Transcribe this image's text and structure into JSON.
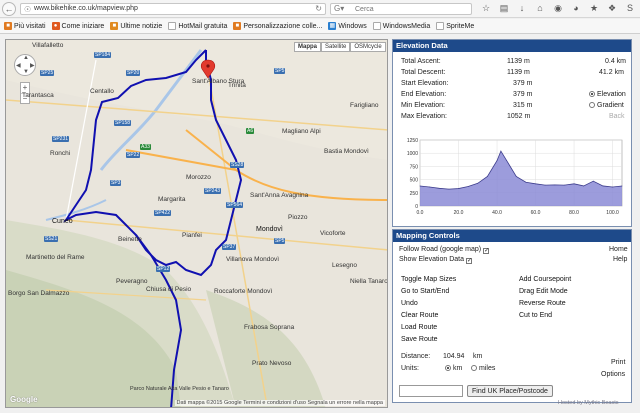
{
  "browser": {
    "url": "www.bikehike.co.uk/mapview.php",
    "search_placeholder": "Cerca",
    "bookmarks": [
      "Più visitati",
      "Come iniziare",
      "Ultime notizie",
      "HotMail gratuita",
      "Personalizzazione colle...",
      "Windows",
      "WindowsMedia",
      "SpriteMe"
    ]
  },
  "map": {
    "type_buttons": [
      "Mappa",
      "Satellite",
      "OSMcycle"
    ],
    "places": [
      {
        "name": "Villafalletto",
        "big": false
      },
      {
        "name": "Tarantasca",
        "big": false
      },
      {
        "name": "Centallo",
        "big": false
      },
      {
        "name": "Ronchi",
        "big": false
      },
      {
        "name": "Cuneo",
        "big": true
      },
      {
        "name": "Borgo San Dalmazzo",
        "big": false
      },
      {
        "name": "Martinetto del Rame",
        "big": false
      },
      {
        "name": "Beinette",
        "big": false
      },
      {
        "name": "Peveragno",
        "big": false
      },
      {
        "name": "Chiusa di Pesio",
        "big": false
      },
      {
        "name": "Margarita",
        "big": false
      },
      {
        "name": "Morozzo",
        "big": false
      },
      {
        "name": "Pianfei",
        "big": false
      },
      {
        "name": "Villanova Mondovì",
        "big": false
      },
      {
        "name": "Mondovì",
        "big": true
      },
      {
        "name": "Roccaforte Mondovì",
        "big": false
      },
      {
        "name": "Frabosa Soprana",
        "big": false
      },
      {
        "name": "Prato Nevoso",
        "big": false
      },
      {
        "name": "Sant'Albano Stura",
        "big": false
      },
      {
        "name": "Trinità",
        "big": false
      },
      {
        "name": "Magliano Alpi",
        "big": false
      },
      {
        "name": "Sant'Anna Avagnina",
        "big": false
      },
      {
        "name": "Piozzo",
        "big": false
      },
      {
        "name": "Vicoforte",
        "big": false
      },
      {
        "name": "Bastia Mondovì",
        "big": false
      },
      {
        "name": "Farigliano",
        "big": false
      },
      {
        "name": "Niella Tanaro",
        "big": false
      },
      {
        "name": "Lesegno",
        "big": false
      },
      {
        "name": "Parco Naturale Alta Valle Pesio e Tanaro",
        "big": false
      }
    ],
    "roads": [
      "SP184",
      "SP20",
      "SP25",
      "SP231",
      "SP158",
      "SP3",
      "SP22",
      "SP5",
      "A6",
      "A33",
      "SS21",
      "SP422",
      "SP243",
      "SS28",
      "SP37",
      "SP564",
      "SP12",
      "SP5"
    ],
    "footer": "Dati mappa ©2015 Google    Termini e condizioni d'uso    Segnala un errore nella mappa",
    "logo": "Google"
  },
  "elevation_panel": {
    "title": "Elevation Data",
    "stats": [
      {
        "label": "Total Ascent:",
        "value": "1139 m",
        "alt": "0.4 km"
      },
      {
        "label": "Total Descent:",
        "value": "1139 m",
        "alt": "41.2 km"
      },
      {
        "label": "Start Elevation:",
        "value": "379 m",
        "alt": ""
      },
      {
        "label": "End Elevation:",
        "value": "379 m",
        "alt": ""
      },
      {
        "label": "Min Elevation:",
        "value": "315 m",
        "alt": ""
      },
      {
        "label": "Max Elevation:",
        "value": "1052 m",
        "alt": ""
      }
    ],
    "option_elevation": "Elevation",
    "option_gradient": "Gradient",
    "back": "Back"
  },
  "chart_data": {
    "type": "area",
    "x": [
      0,
      5,
      10,
      15,
      20,
      25,
      30,
      35,
      40,
      42,
      45,
      50,
      55,
      60,
      65,
      70,
      75,
      80,
      85,
      90,
      95,
      100,
      104.9
    ],
    "y": [
      379,
      360,
      335,
      320,
      330,
      370,
      430,
      560,
      860,
      1040,
      860,
      560,
      450,
      420,
      395,
      400,
      395,
      420,
      380,
      470,
      380,
      360,
      379
    ],
    "xlim": [
      0,
      104.9
    ],
    "ylim": [
      0,
      1250
    ],
    "xticks": [
      "0.0",
      "20.0",
      "40.0",
      "60.0",
      "80.0",
      "100.0"
    ],
    "yticks": [
      "0",
      "250",
      "500",
      "750",
      "1000",
      "1250"
    ],
    "fill": "#8b8bd6",
    "line": "#3c3c8c",
    "grid": true
  },
  "controls_panel": {
    "title": "Mapping Controls",
    "follow_road": "Follow Road (google map)",
    "show_elevation": "Show Elevation Data",
    "home": "Home",
    "help": "Help",
    "left_links": [
      "Toggle Map Sizes",
      "Go to Start/End",
      "Undo",
      "Clear Route",
      "Load Route",
      "Save Route"
    ],
    "right_links": [
      "Add Coursepoint",
      "Drag Edit Mode",
      "Reverse Route",
      "Cut to End"
    ],
    "distance_label": "Distance:",
    "distance_value": "104.94",
    "distance_unit": "km",
    "units_label": "Units:",
    "unit_km": "km",
    "unit_miles": "miles",
    "print": "Print",
    "options": "Options",
    "find_button": "Find UK Place/Postcode",
    "hosted": "Hosted by Mythic Beasts"
  }
}
